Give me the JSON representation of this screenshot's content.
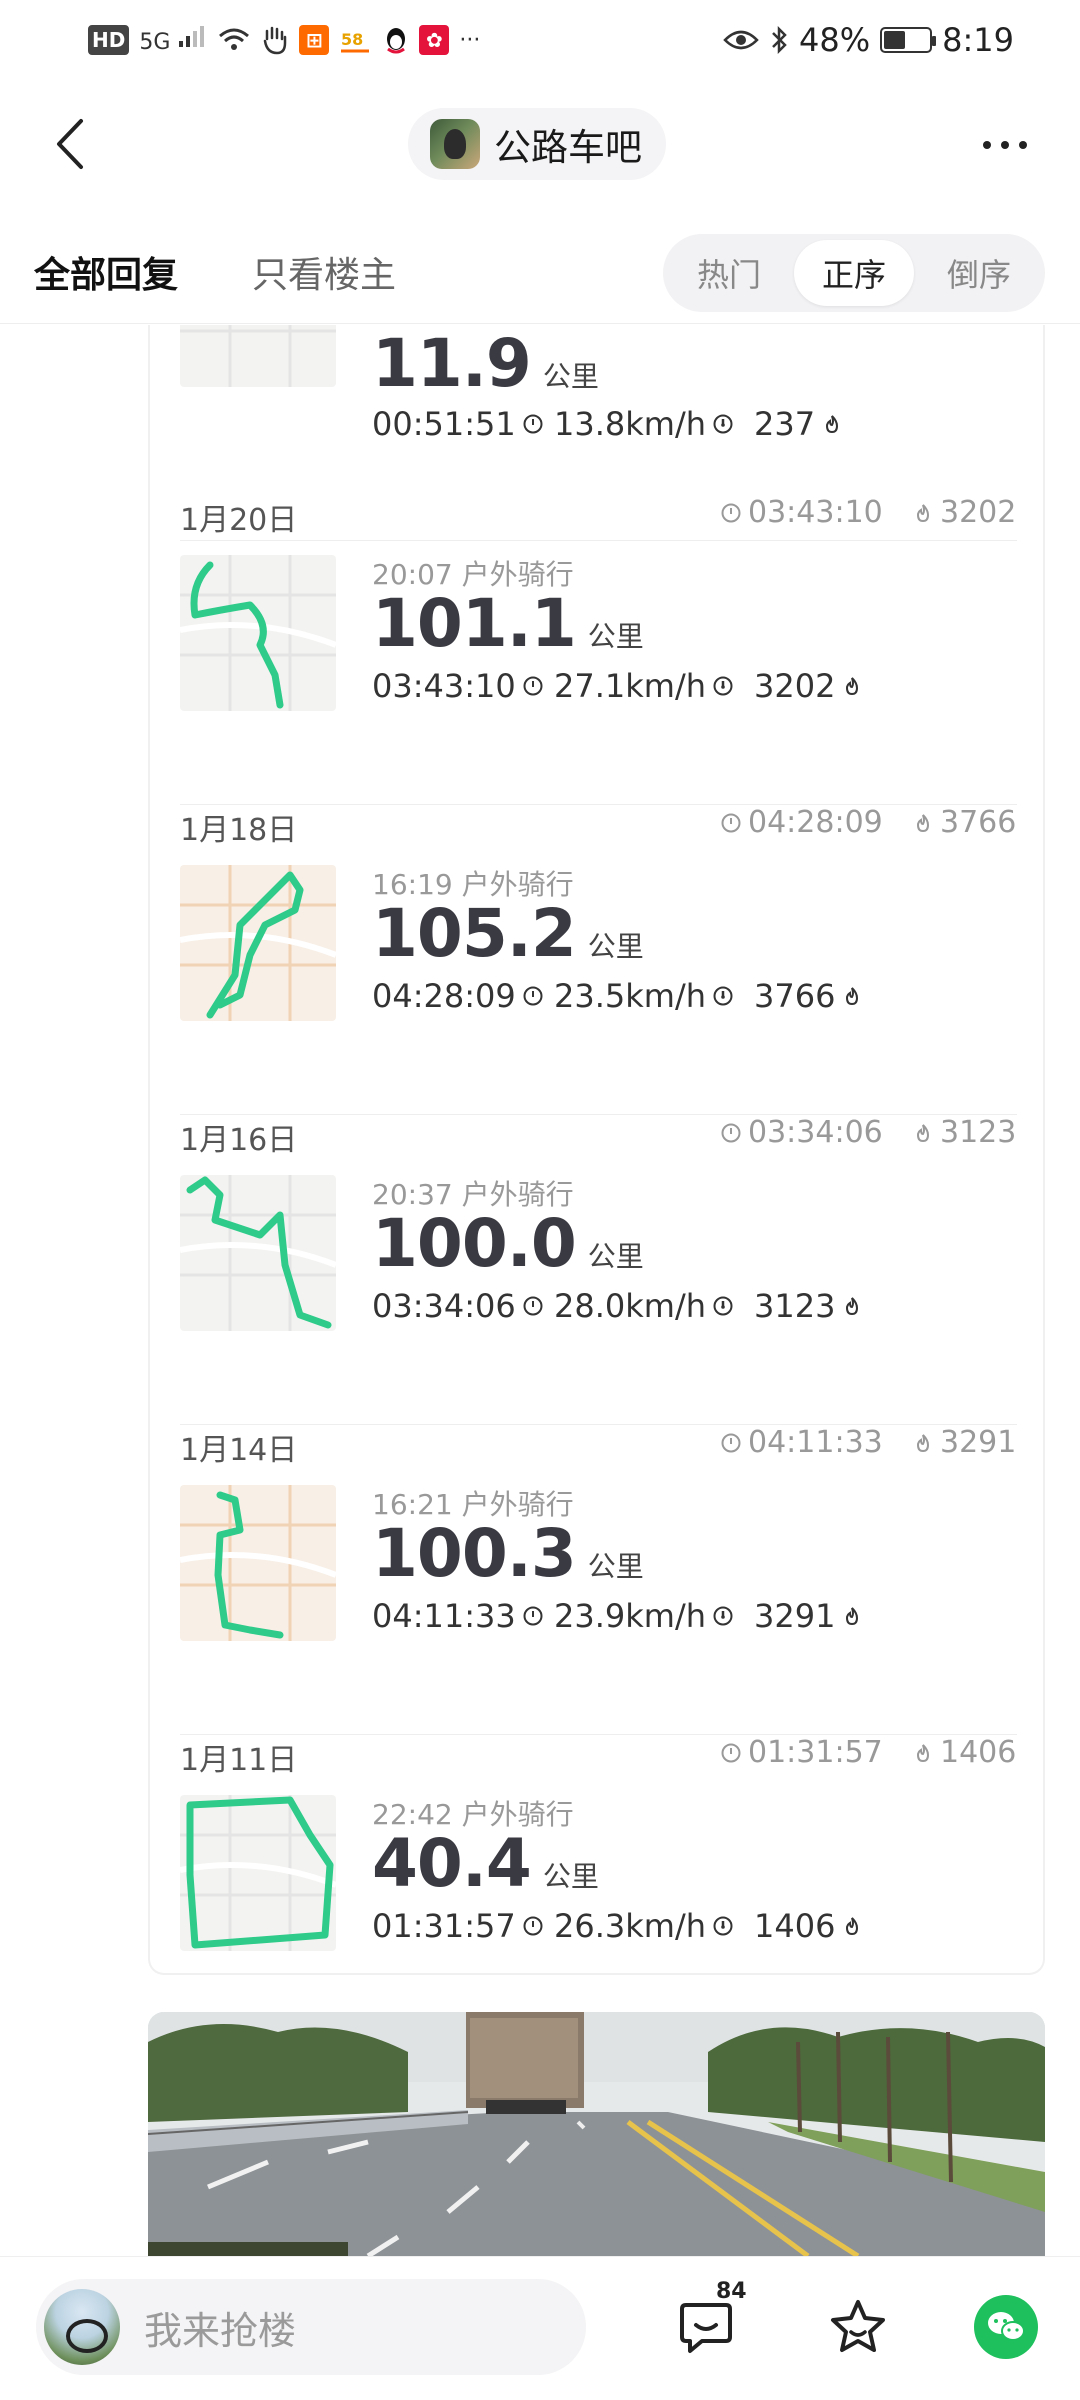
{
  "status_bar": {
    "left_icons": [
      "hd-icon",
      "signal-5g-icon",
      "wifi-icon",
      "hand-icon",
      "app-orange-icon",
      "app-58-icon",
      "qq-penguin-icon",
      "app-red-icon",
      "more-notifications-icon"
    ],
    "hd": "HD",
    "net": "5G",
    "overflow": "···",
    "battery_text": "48%",
    "battery_level": 0.48,
    "time": "8:19"
  },
  "header": {
    "forum_name": "公路车吧"
  },
  "tabs": {
    "all_replies": "全部回复",
    "owner_only": "只看楼主",
    "sort": [
      "热门",
      "正序",
      "倒序"
    ],
    "sort_selected": "正序"
  },
  "records": [
    {
      "date": "",
      "sum_time": "",
      "sum_cal": "",
      "subtitle": "",
      "distance": "11.9",
      "unit": "公里",
      "time": "00:51:51",
      "speed": "13.8km/h",
      "calories": "237"
    },
    {
      "date": "1月20日",
      "sum_time": "03:43:10",
      "sum_cal": "3202",
      "subtitle": "20:07 户外骑行",
      "distance": "101.1",
      "unit": "公里",
      "time": "03:43:10",
      "speed": "27.1km/h",
      "calories": "3202"
    },
    {
      "date": "1月18日",
      "sum_time": "04:28:09",
      "sum_cal": "3766",
      "subtitle": "16:19 户外骑行",
      "distance": "105.2",
      "unit": "公里",
      "time": "04:28:09",
      "speed": "23.5km/h",
      "calories": "3766"
    },
    {
      "date": "1月16日",
      "sum_time": "03:34:06",
      "sum_cal": "3123",
      "subtitle": "20:37 户外骑行",
      "distance": "100.0",
      "unit": "公里",
      "time": "03:34:06",
      "speed": "28.0km/h",
      "calories": "3123"
    },
    {
      "date": "1月14日",
      "sum_time": "04:11:33",
      "sum_cal": "3291",
      "subtitle": "16:21 户外骑行",
      "distance": "100.3",
      "unit": "公里",
      "time": "04:11:33",
      "speed": "23.9km/h",
      "calories": "3291"
    },
    {
      "date": "1月11日",
      "sum_time": "01:31:57",
      "sum_cal": "1406",
      "subtitle": "22:42 户外骑行",
      "distance": "40.4",
      "unit": "公里",
      "time": "01:31:57",
      "speed": "26.3km/h",
      "calories": "1406"
    }
  ],
  "route_color": "#2ecb8a",
  "bottom_bar": {
    "reply_placeholder": "我来抢楼",
    "comment_count": "84"
  }
}
